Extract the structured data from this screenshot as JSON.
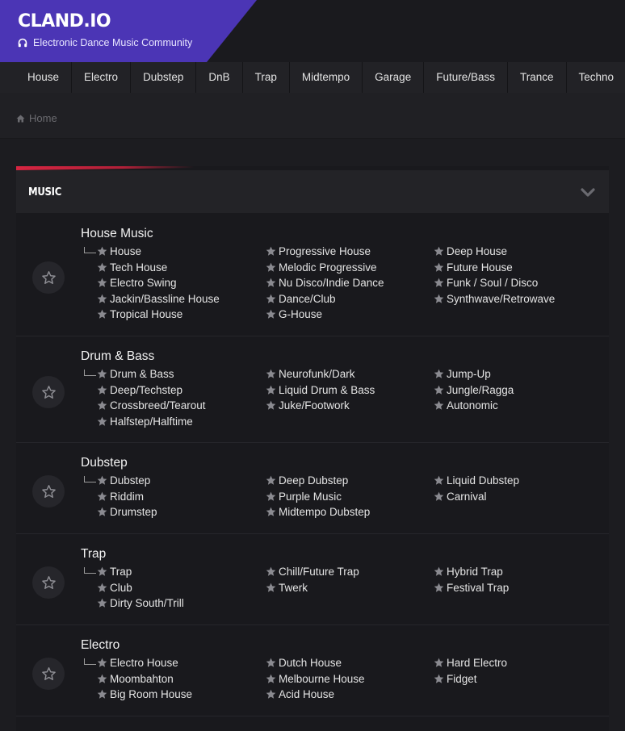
{
  "brand": {
    "title": "CLAND.IO",
    "subtitle": "Electronic Dance Music Community",
    "accent_color": "#4b35b5",
    "subtitle_icon": "headphones-icon"
  },
  "nav": {
    "items": [
      "House",
      "Electro",
      "Dubstep",
      "DnB",
      "Trap",
      "Midtempo",
      "Garage",
      "Future/Bass",
      "Trance",
      "Techno"
    ]
  },
  "breadcrumb": {
    "icon": "home-icon",
    "label": "Home"
  },
  "panel": {
    "title": "MUSIC",
    "accent_color": "#d62541",
    "collapse_icon": "chevron-down-icon"
  },
  "forums": [
    {
      "title": "House Music",
      "columns": [
        [
          "House",
          "Tech House",
          "Electro Swing",
          "Jackin/Bassline House",
          "Tropical House"
        ],
        [
          "Progressive House",
          "Melodic Progressive",
          "Nu Disco/Indie Dance",
          "Dance/Club",
          "G-House"
        ],
        [
          "Deep House",
          "Future House",
          "Funk / Soul / Disco",
          "Synthwave/Retrowave"
        ]
      ]
    },
    {
      "title": "Drum & Bass",
      "columns": [
        [
          "Drum & Bass",
          "Deep/Techstep",
          "Crossbreed/Tearout",
          "Halfstep/Halftime"
        ],
        [
          "Neurofunk/Dark",
          "Liquid Drum & Bass",
          "Juke/Footwork"
        ],
        [
          "Jump-Up",
          "Jungle/Ragga",
          "Autonomic"
        ]
      ]
    },
    {
      "title": "Dubstep",
      "columns": [
        [
          "Dubstep",
          "Riddim",
          "Drumstep"
        ],
        [
          "Deep Dubstep",
          "Purple Music",
          "Midtempo Dubstep"
        ],
        [
          "Liquid Dubstep",
          "Carnival"
        ]
      ]
    },
    {
      "title": "Trap",
      "columns": [
        [
          "Trap",
          "Club",
          "Dirty South/Trill"
        ],
        [
          "Chill/Future Trap",
          "Twerk"
        ],
        [
          "Hybrid Trap",
          "Festival Trap"
        ]
      ]
    },
    {
      "title": "Electro",
      "columns": [
        [
          "Electro House",
          "Moombahton",
          "Big Room House"
        ],
        [
          "Dutch House",
          "Melbourne House",
          "Acid House"
        ],
        [
          "Hard Electro",
          "Fidget"
        ]
      ]
    }
  ]
}
